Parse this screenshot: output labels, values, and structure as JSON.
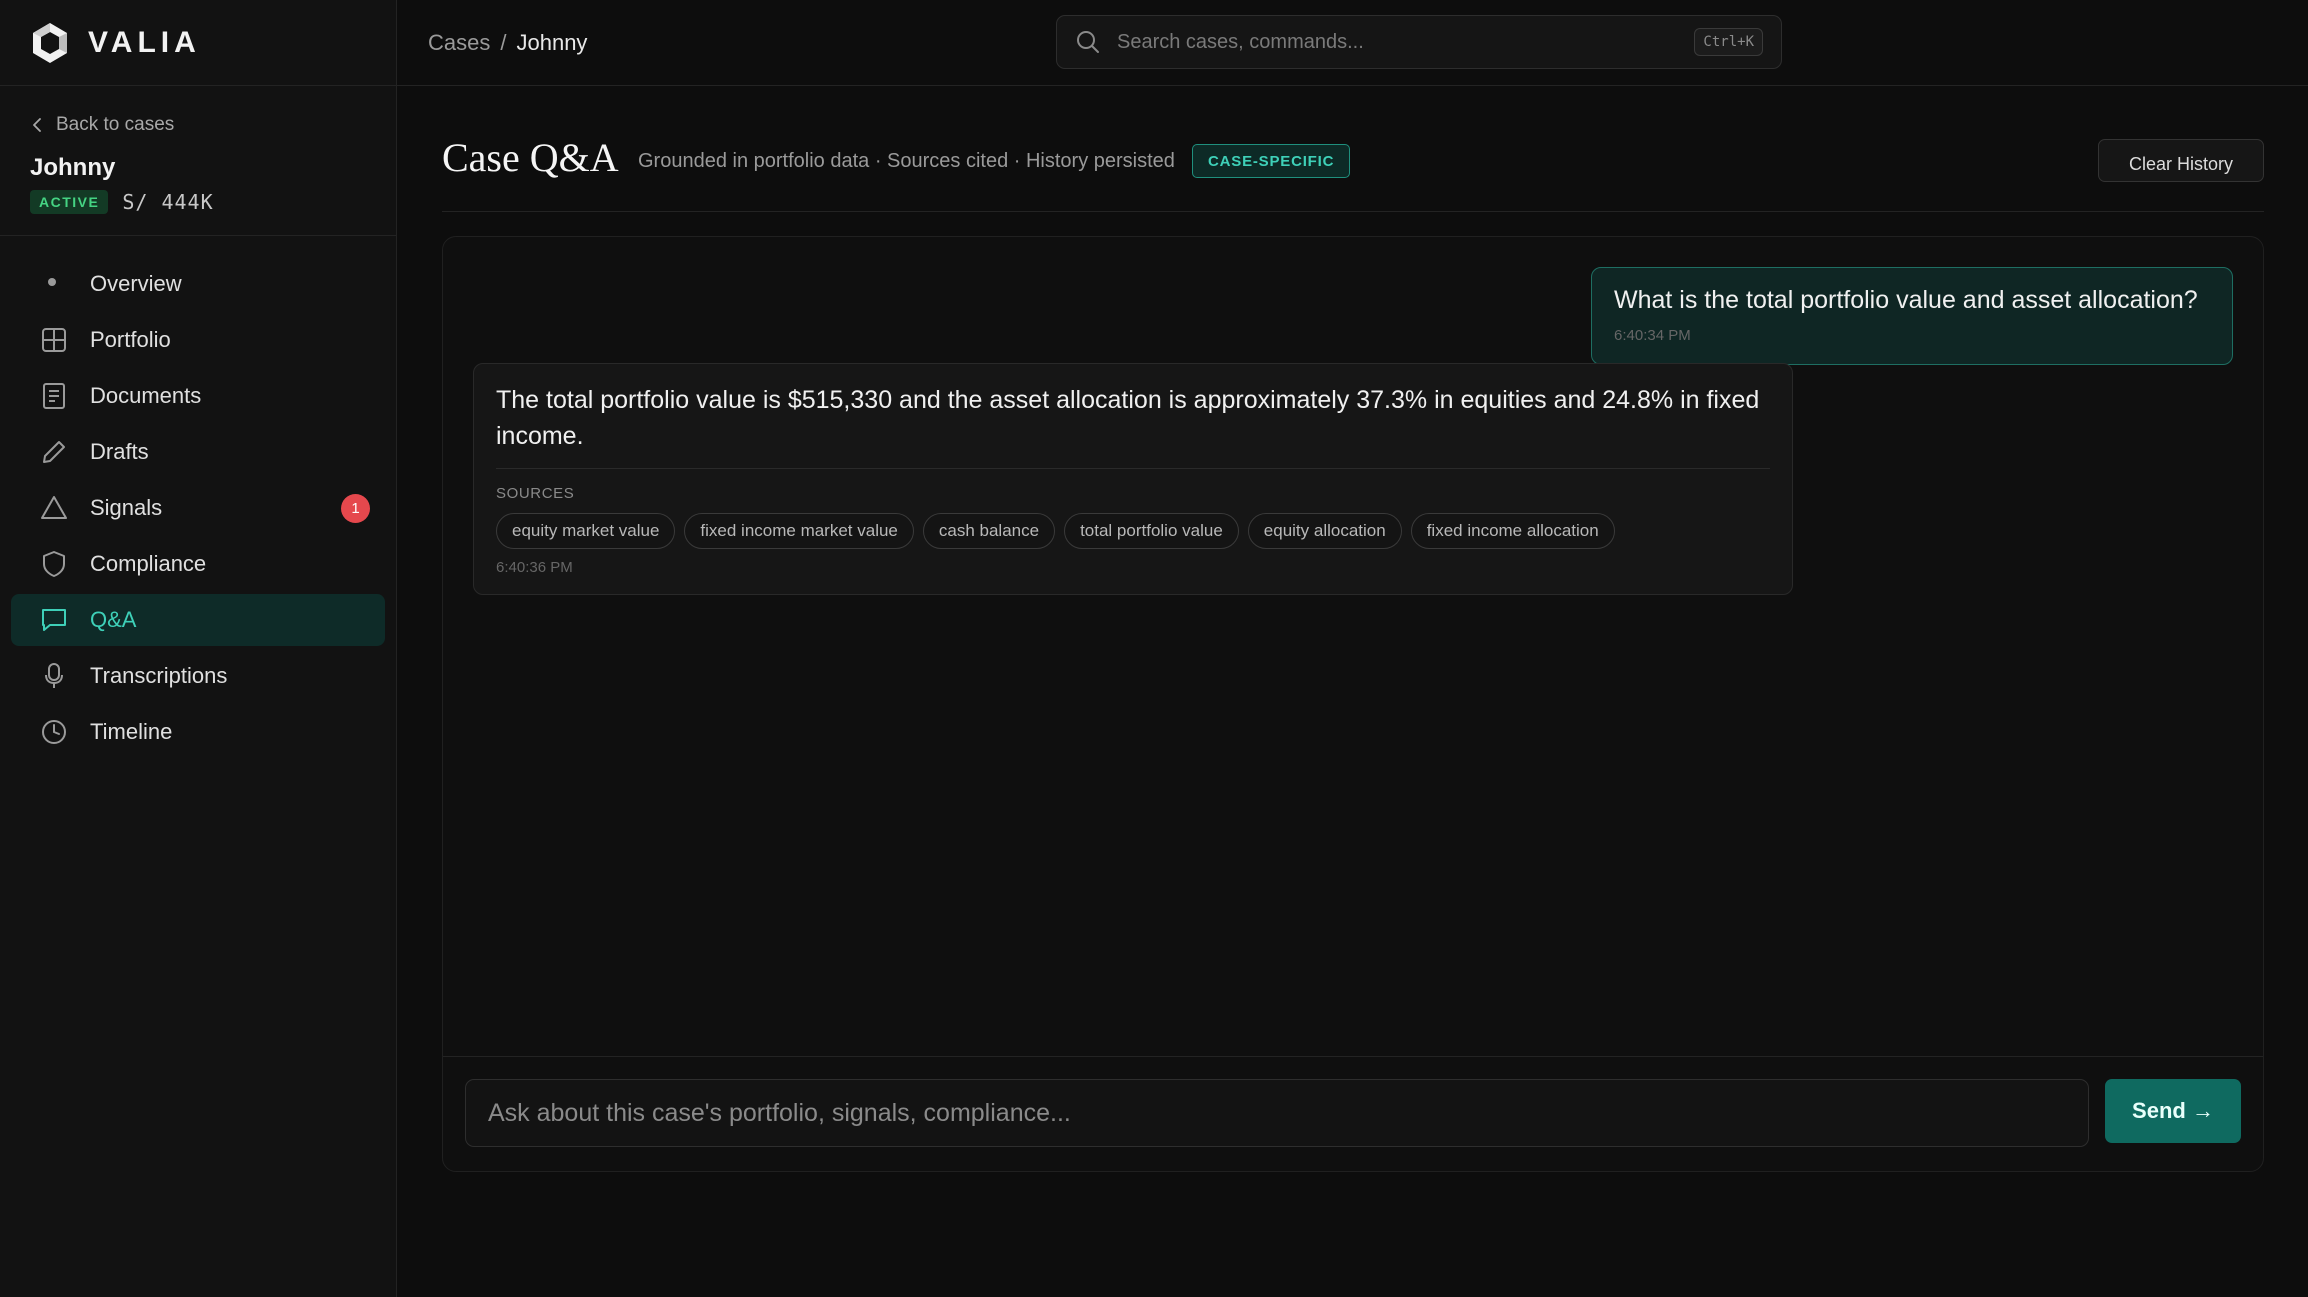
{
  "brand": {
    "name": "VALIA"
  },
  "case": {
    "back_label": "Back to cases",
    "name": "Johnny",
    "status": "ACTIVE",
    "code": "S/ 444K"
  },
  "nav": {
    "items": [
      {
        "label": "Overview",
        "icon": "dot-icon"
      },
      {
        "label": "Portfolio",
        "icon": "grid-icon"
      },
      {
        "label": "Documents",
        "icon": "document-icon"
      },
      {
        "label": "Drafts",
        "icon": "pencil-icon"
      },
      {
        "label": "Signals",
        "icon": "triangle-icon",
        "badge": "1"
      },
      {
        "label": "Compliance",
        "icon": "shield-icon"
      },
      {
        "label": "Q&A",
        "icon": "chat-icon",
        "active": true
      },
      {
        "label": "Transcriptions",
        "icon": "microphone-icon"
      },
      {
        "label": "Timeline",
        "icon": "clock-icon"
      }
    ]
  },
  "topbar": {
    "breadcrumb": {
      "parent": "Cases",
      "separator": "/",
      "current": "Johnny"
    },
    "search": {
      "placeholder": "Search cases, commands...",
      "shortcut": "Ctrl+K"
    }
  },
  "page": {
    "title": "Case Q&A",
    "subtitle": "Grounded in portfolio data · Sources cited · History persisted",
    "tag": "CASE-SPECIFIC",
    "clear_label": "Clear History"
  },
  "messages": {
    "user": {
      "text": "What is the total portfolio value and asset allocation?",
      "time": "6:40:34 PM"
    },
    "assistant": {
      "text": "The total portfolio value is $515,330 and the asset allocation is approximately 37.3% in equities and 24.8% in fixed income.",
      "sources_label": "SOURCES",
      "sources": [
        "equity market value",
        "fixed income market value",
        "cash balance",
        "total portfolio value",
        "equity allocation",
        "fixed income allocation"
      ],
      "time": "6:40:36 PM"
    }
  },
  "composer": {
    "placeholder": "Ask about this case's portfolio, signals, compliance...",
    "send_label": "Send →"
  },
  "colors": {
    "accent": "#3ed0b8",
    "accent_bg": "#0e2b28",
    "active_badge": "#45d483",
    "alert": "#e5484d",
    "send_button": "#0f6a60"
  }
}
